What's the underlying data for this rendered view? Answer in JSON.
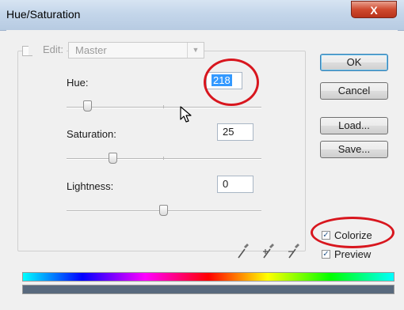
{
  "window": {
    "title": "Hue/Saturation",
    "close_glyph": "X"
  },
  "edit": {
    "label": "Edit:",
    "value": "Master"
  },
  "hue": {
    "label": "Hue:",
    "value": "218",
    "level": 218
  },
  "saturation": {
    "label": "Saturation:",
    "value": "25",
    "level": 25
  },
  "lightness": {
    "label": "Lightness:",
    "value": "0",
    "level": 0
  },
  "buttons": {
    "ok": "OK",
    "cancel": "Cancel",
    "load": "Load...",
    "save": "Save..."
  },
  "options": {
    "colorize": "Colorize",
    "colorize_checked": true,
    "preview": "Preview",
    "preview_checked": true
  },
  "icons": [
    "eyedropper-icon",
    "eyedropper-plus-icon",
    "eyedropper-minus-icon",
    "pointer-cursor-icon"
  ],
  "colors": {
    "annotation": "#d8161e",
    "result_color": "#58697d",
    "selection": "#3399ff"
  }
}
